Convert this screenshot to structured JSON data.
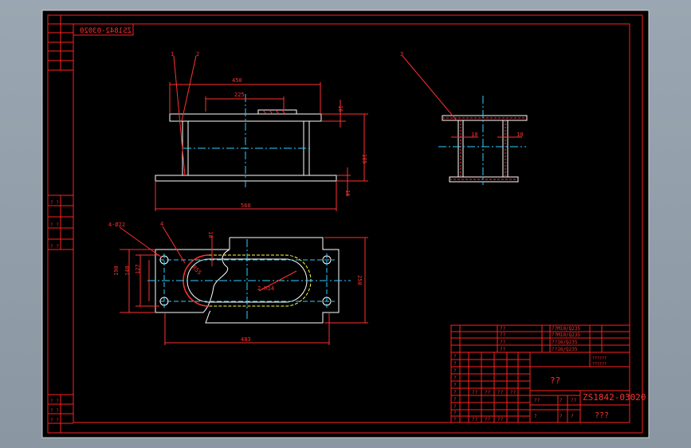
{
  "drawing": {
    "part_number": "ZS1842-03020",
    "part_number_mirrored": "ZS1842-03020",
    "title_placeholder": "??",
    "subtitle_placeholder": "???",
    "company_line1": "??????",
    "company_line2": "??????",
    "row_placeholder": "??",
    "cell_placeholder": "?",
    "side_marks": [
      "? ?",
      "? ?",
      "? ?",
      "? ?",
      "? ?",
      "? ?"
    ]
  },
  "bom": {
    "rows": [
      {
        "name": "??",
        "spec": "??M10/Q235"
      },
      {
        "name": "??",
        "spec": "??M10/Q235"
      },
      {
        "name": "??",
        "spec": "??16/Q235"
      },
      {
        "name": "??",
        "spec": "??16/Q235"
      }
    ]
  },
  "labels": {
    "callout_1": "1",
    "callout_2": "2",
    "callout_3": "3",
    "callout_4": "4",
    "holes": "4-Ø22",
    "thread": "2-M14",
    "radius": "R55"
  },
  "dimensions": {
    "d450": "450",
    "d225": "225",
    "d16a": "16",
    "d185": "185",
    "d16b": "16",
    "d560": "560",
    "d10a": "10",
    "d10b": "10",
    "d10c": "10",
    "d190": "190",
    "d140": "140",
    "d127": "127",
    "d250": "250",
    "d483": "483"
  },
  "colors": {
    "background": "#000000",
    "frame": "#ff2020",
    "outline": "#ffffff",
    "center": "#30d0ff",
    "hidden": "#ffff40",
    "dimension": "#ff3030"
  }
}
